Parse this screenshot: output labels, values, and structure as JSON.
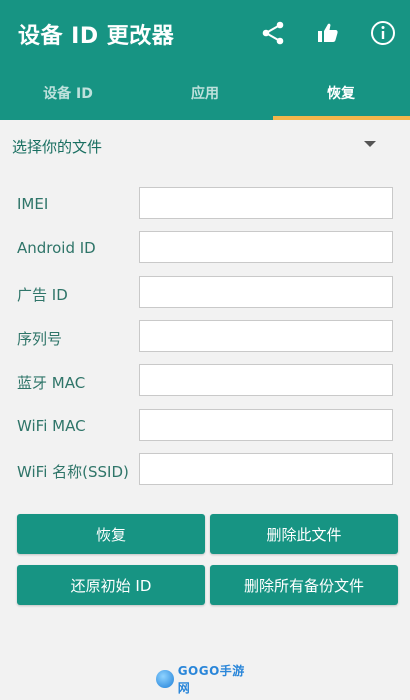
{
  "app": {
    "title": "设备 ID 更改器",
    "colors": {
      "primary": "#179483",
      "tab_indicator": "#f2b64b",
      "label": "#2f7569"
    },
    "icons": [
      "share-icon",
      "thumbs-up-icon",
      "info-icon"
    ]
  },
  "tabs": [
    {
      "label": "设备 ID",
      "selected": false
    },
    {
      "label": "应用",
      "selected": false
    },
    {
      "label": "恢复",
      "selected": true
    }
  ],
  "chooser": {
    "label": "选择你的文件"
  },
  "fields": {
    "imei": {
      "label": "IMEI",
      "value": ""
    },
    "android_id": {
      "label": "Android ID",
      "value": ""
    },
    "ad_id": {
      "label": "广告 ID",
      "value": ""
    },
    "serial": {
      "label": "序列号",
      "value": ""
    },
    "bt_mac": {
      "label": "蓝牙 MAC",
      "value": ""
    },
    "wifi_mac": {
      "label": "WiFi MAC",
      "value": ""
    },
    "wifi_ssid": {
      "label": "WiFi 名称(SSID)",
      "value": ""
    }
  },
  "buttons": {
    "restore": "恢复",
    "delete_file": "删除此文件",
    "restore_original": "还原初始 ID",
    "delete_all": "删除所有备份文件"
  },
  "watermark": {
    "text": "GOGO手游网"
  }
}
